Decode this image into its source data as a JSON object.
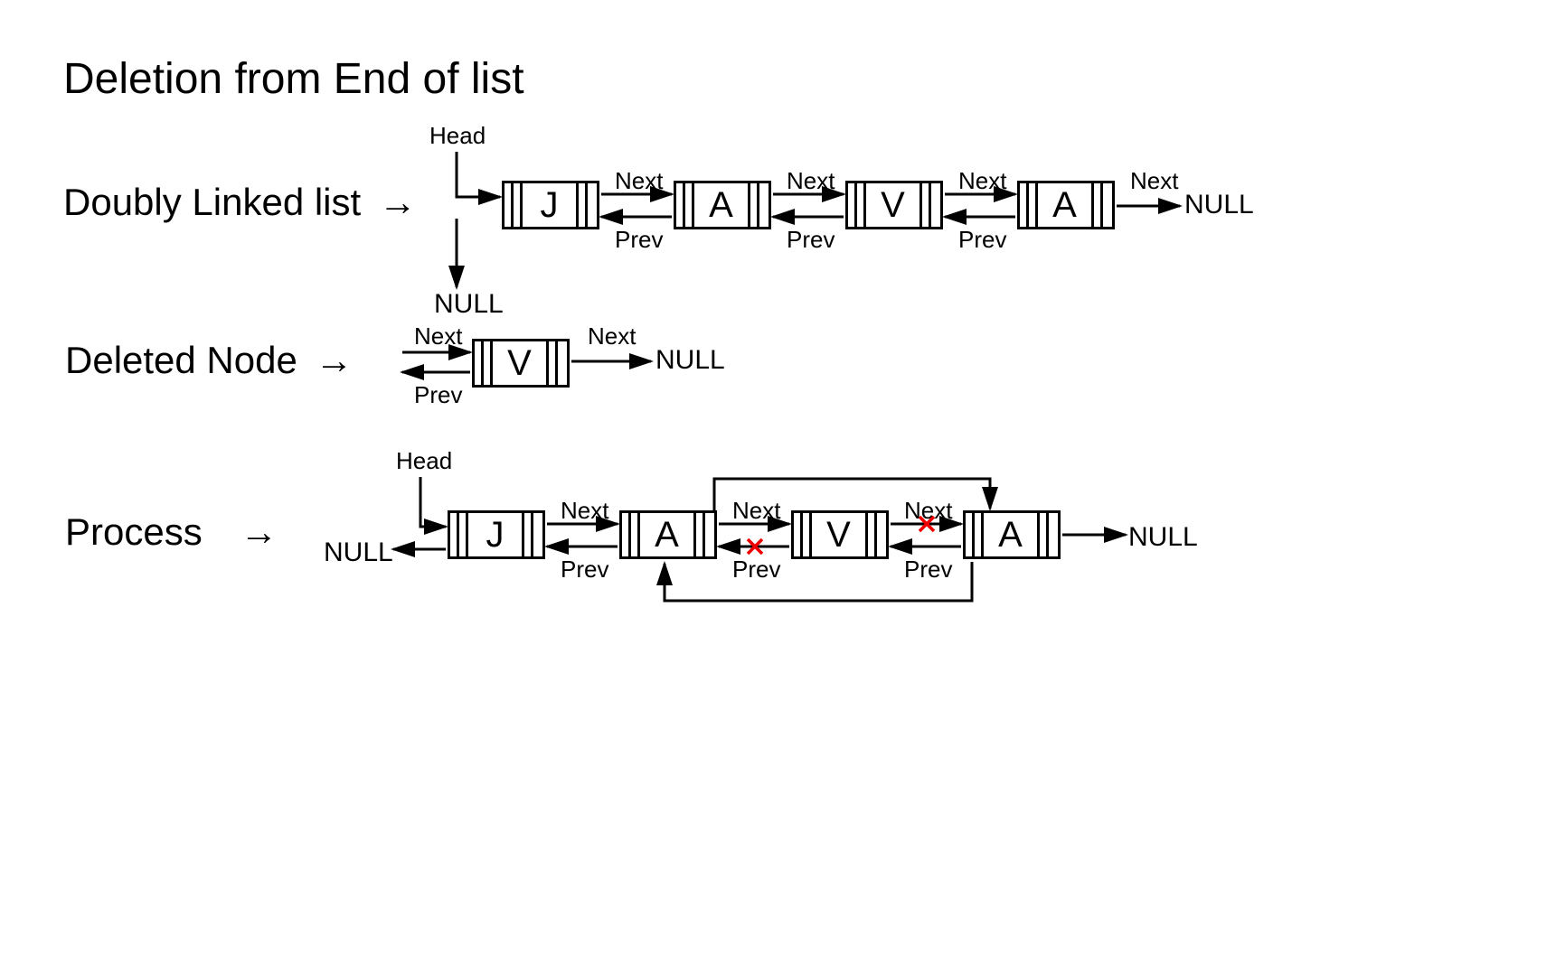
{
  "title": "Deletion from End of list",
  "rows": {
    "dll": {
      "label": "Doubly Linked list",
      "arrow": "→"
    },
    "deleted": {
      "label": "Deleted Node",
      "arrow": "→"
    },
    "process": {
      "label": "Process",
      "arrow": "→"
    }
  },
  "labels": {
    "head": "Head",
    "next": "Next",
    "prev": "Prev",
    "null": "NULL"
  },
  "nodes": {
    "dll": [
      "J",
      "A",
      "V",
      "A"
    ],
    "deleted": [
      "V"
    ],
    "process": [
      "J",
      "A",
      "V",
      "A"
    ]
  },
  "diagram": {
    "type": "doubly-linked-list-deletion",
    "operation": "delete-from-end",
    "original_list": [
      "J",
      "A",
      "V",
      "A"
    ],
    "deleted_node_value": "V",
    "deleted_node_index": 2,
    "resulting_list": [
      "J",
      "A",
      "A"
    ],
    "head_points_to": "J",
    "tail_next": "NULL",
    "head_prev": "NULL",
    "process_bypasses": [
      {
        "pointer": "next",
        "from_index": 1,
        "to_index": 3
      },
      {
        "pointer": "prev",
        "from_index": 3,
        "to_index": 1
      }
    ],
    "crossed_links": [
      {
        "pointer": "next",
        "from_index": 2,
        "to_index": 3
      },
      {
        "pointer": "prev",
        "from_index": 2,
        "to_index": 1
      }
    ]
  }
}
